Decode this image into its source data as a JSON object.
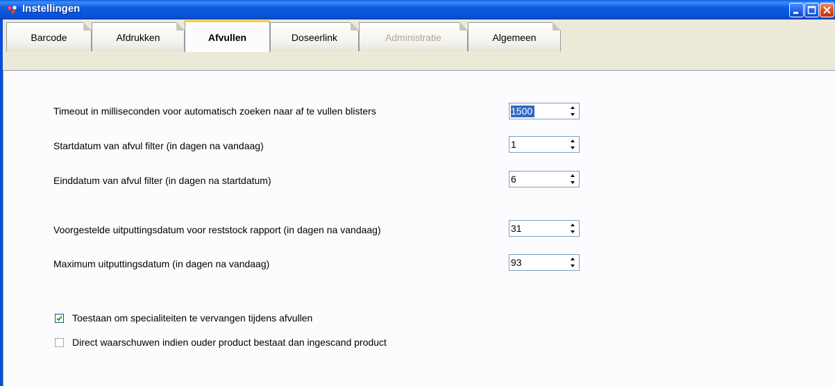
{
  "window": {
    "title": "Instellingen",
    "icon": "app-logo-icon",
    "controls": [
      "minimize-icon",
      "maximize-icon",
      "close-icon"
    ]
  },
  "tabs": [
    {
      "label": "Barcode",
      "state": "normal"
    },
    {
      "label": "Afdrukken",
      "state": "normal"
    },
    {
      "label": "Afvullen",
      "state": "active"
    },
    {
      "label": "Doseerlink",
      "state": "normal"
    },
    {
      "label": "Administratie",
      "state": "disabled"
    },
    {
      "label": "Algemeen",
      "state": "normal"
    }
  ],
  "settings": {
    "timeout": {
      "label": "Timeout in milliseconden voor automatisch zoeken naar af te vullen blisters",
      "value": "1500"
    },
    "startdatum": {
      "label": "Startdatum van afvul filter (in dagen na vandaag)",
      "value": "1"
    },
    "einddatum": {
      "label": "Einddatum van afvul filter (in dagen na startdatum)",
      "value": "6"
    },
    "voorgestelde": {
      "label": "Voorgestelde uitputtingsdatum voor reststock rapport (in dagen na vandaag)",
      "value": "31"
    },
    "maximum": {
      "label": "Maximum uitputtingsdatum (in dagen na vandaag)",
      "value": "93"
    }
  },
  "checkboxes": {
    "toestaan": {
      "label": "Toestaan om specialiteiten te vervangen tijdens afvullen",
      "checked": true
    },
    "direct": {
      "label": "Direct waarschuwen indien ouder product bestaat dan ingescand product",
      "checked": false
    }
  },
  "colors": {
    "titlebar": "#0a5fe6",
    "active_tab_accent": "#ffc83c",
    "selection": "#316ac5"
  }
}
